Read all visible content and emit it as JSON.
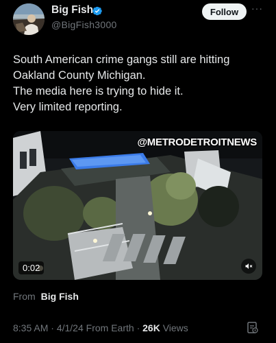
{
  "author": {
    "name": "Big Fish",
    "handle": "@BigFish3000"
  },
  "follow_label": "Follow",
  "more_label": "···",
  "tweet_lines": [
    "South American crime gangs still are hitting",
    "Oakland County Michigan.",
    "The media here is trying to hide it.",
    "Very limited reporting."
  ],
  "media": {
    "watermark": "@METRODETROITNEWS",
    "duration": "0:02"
  },
  "source": {
    "label": "From",
    "name": "Big Fish"
  },
  "meta": {
    "time": "8:35 AM",
    "separator": "·",
    "date": "4/1/24",
    "client": "From Earth",
    "views_count": "26K",
    "views_label": "Views"
  },
  "colors": {
    "background": "#000000",
    "verified_badge": "#1d9bf0",
    "secondary_text": "#71767b",
    "pool": "#3b7be8"
  },
  "icons": [
    "verified-badge-icon",
    "more-options-icon",
    "mute-icon",
    "analytics-icon"
  ]
}
